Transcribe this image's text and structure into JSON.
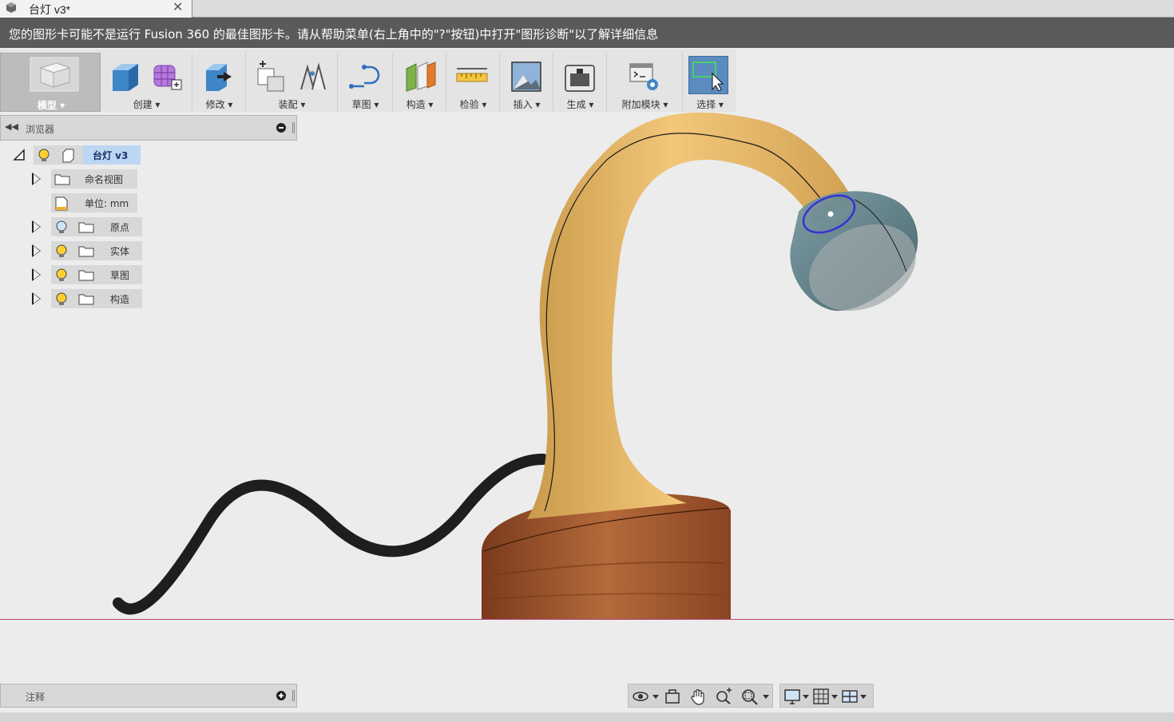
{
  "tab": {
    "title": "台灯 v3*",
    "close_icon": "close-icon"
  },
  "banner": {
    "text": "您的图形卡可能不是运行 Fusion 360 的最佳图形卡。请从帮助菜单(右上角中的\"?\"按钮)中打开\"图形诊断\"以了解详细信息"
  },
  "toolbar": {
    "workspace": "模型 ▾",
    "groups": {
      "create": "创建 ▾",
      "modify": "修改 ▾",
      "assemble": "装配 ▾",
      "sketch": "草图 ▾",
      "construct": "构造 ▾",
      "inspect": "检验 ▾",
      "insert": "插入 ▾",
      "make": "生成 ▾",
      "addins": "附加模块 ▾",
      "select": "选择 ▾"
    }
  },
  "browser": {
    "title": "浏览器",
    "root": "台灯 v3",
    "items": [
      {
        "label": "命名视图"
      },
      {
        "label": "单位: mm"
      },
      {
        "label": "原点"
      },
      {
        "label": "实体"
      },
      {
        "label": "草图"
      },
      {
        "label": "构造"
      }
    ]
  },
  "annotations": {
    "title": "注释"
  },
  "colors": {
    "banner_bg": "#5a5a5a",
    "select_active": "#5b8bbf",
    "ground_line": "#b2447a",
    "lamp_arm": "#e8b865",
    "lamp_base": "#a0522d",
    "cable": "#1e1e1e",
    "shade": "#5e7f88"
  }
}
